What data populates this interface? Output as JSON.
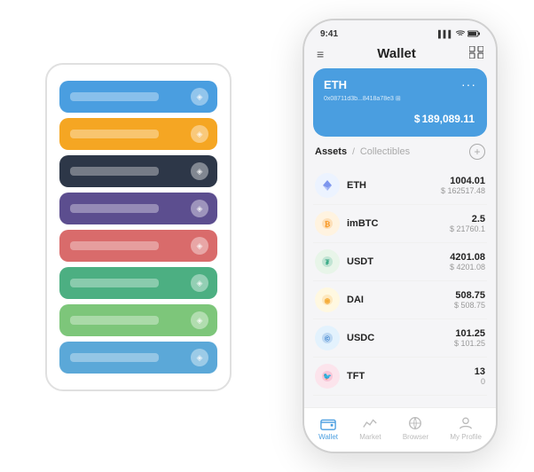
{
  "scene": {
    "background": "#ffffff"
  },
  "card_stack": {
    "cards": [
      {
        "color": "card-blue",
        "label": "",
        "icon": "◈"
      },
      {
        "color": "card-orange",
        "label": "",
        "icon": "◈"
      },
      {
        "color": "card-dark",
        "label": "",
        "icon": "◈"
      },
      {
        "color": "card-purple",
        "label": "",
        "icon": "◈"
      },
      {
        "color": "card-red",
        "label": "",
        "icon": "◈"
      },
      {
        "color": "card-green",
        "label": "",
        "icon": "◈"
      },
      {
        "color": "card-lightgreen",
        "label": "",
        "icon": "◈"
      },
      {
        "color": "card-lightblue",
        "label": "",
        "icon": "◈"
      }
    ]
  },
  "phone": {
    "status_bar": {
      "time": "9:41",
      "signal": "▌▌▌",
      "wifi": "wifi",
      "battery": "battery"
    },
    "header": {
      "menu_icon": "≡",
      "title": "Wallet",
      "expand_icon": "⊡"
    },
    "eth_card": {
      "title": "ETH",
      "dots": "···",
      "address": "0x08711d3b...8418a78e3  ⊞",
      "currency_symbol": "$",
      "balance": "189,089.11"
    },
    "assets": {
      "active_tab": "Assets",
      "separator": "/",
      "inactive_tab": "Collectibles",
      "add_icon": "+"
    },
    "asset_list": [
      {
        "name": "ETH",
        "icon": "♦",
        "icon_class": "asset-icon-eth",
        "amount": "1004.01",
        "usd": "$ 162517.48"
      },
      {
        "name": "imBTC",
        "icon": "₿",
        "icon_class": "asset-icon-imbtc",
        "amount": "2.5",
        "usd": "$ 21760.1"
      },
      {
        "name": "USDT",
        "icon": "₮",
        "icon_class": "asset-icon-usdt",
        "amount": "4201.08",
        "usd": "$ 4201.08"
      },
      {
        "name": "DAI",
        "icon": "◉",
        "icon_class": "asset-icon-dai",
        "amount": "508.75",
        "usd": "$ 508.75"
      },
      {
        "name": "USDC",
        "icon": "©",
        "icon_class": "asset-icon-usdc",
        "amount": "101.25",
        "usd": "$ 101.25"
      },
      {
        "name": "TFT",
        "icon": "🐦",
        "icon_class": "asset-icon-tft",
        "amount": "13",
        "usd": "0"
      }
    ],
    "bottom_nav": [
      {
        "label": "Wallet",
        "active": true
      },
      {
        "label": "Market",
        "active": false
      },
      {
        "label": "Browser",
        "active": false
      },
      {
        "label": "My Profile",
        "active": false
      }
    ]
  }
}
